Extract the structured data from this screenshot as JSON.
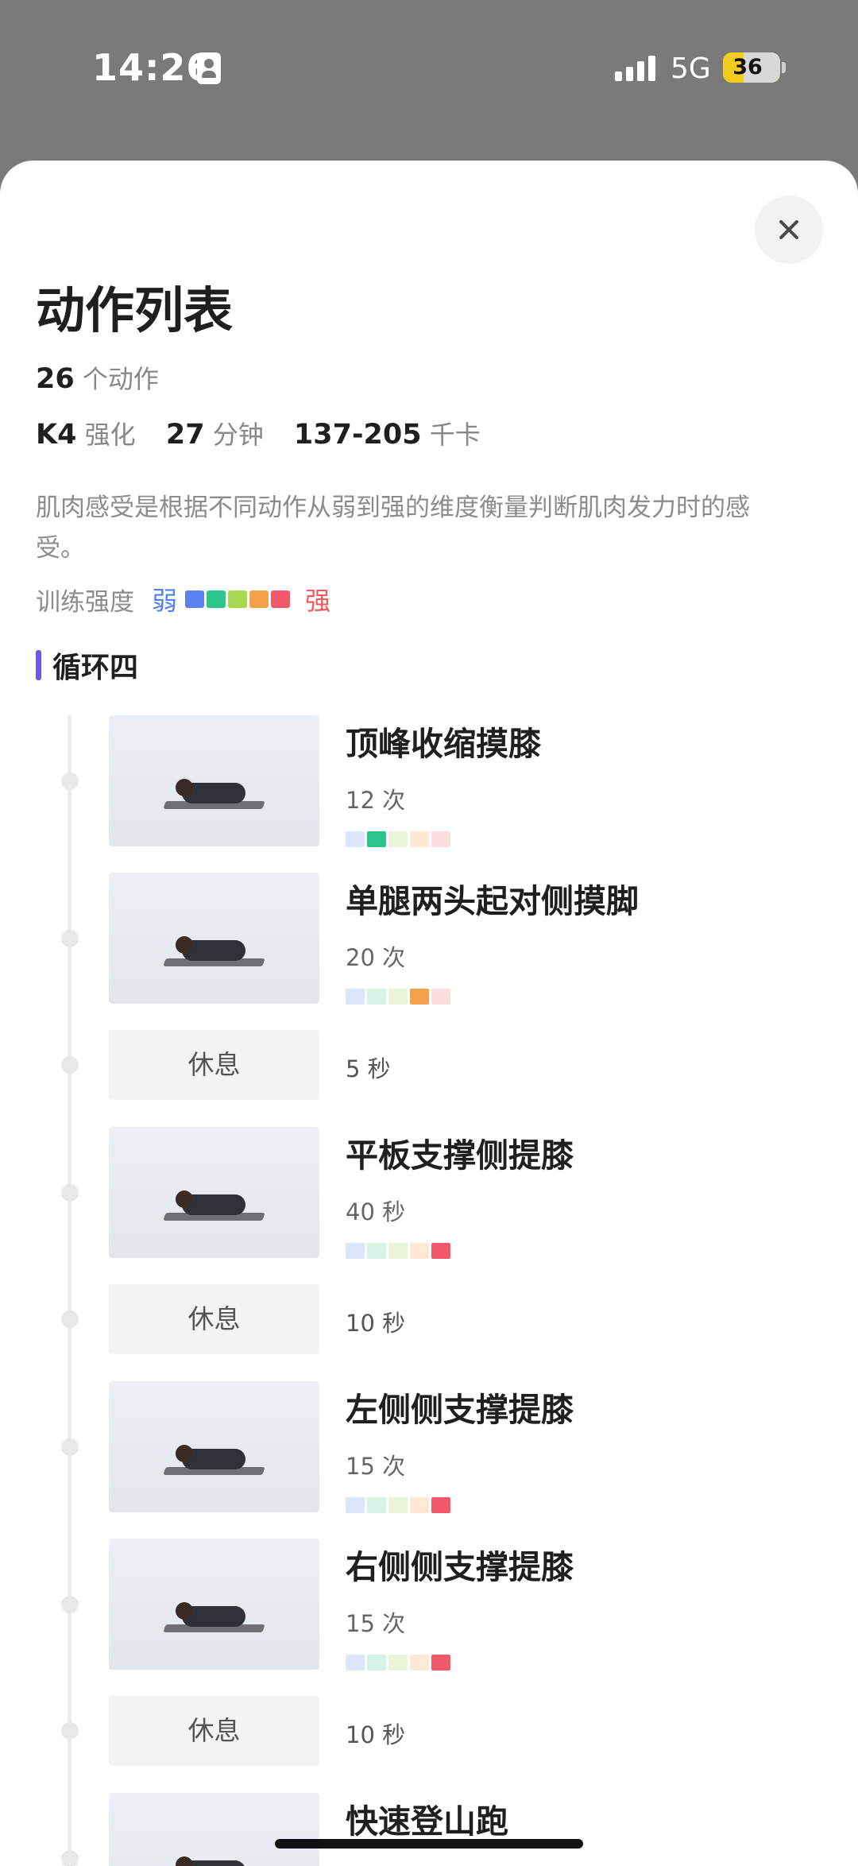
{
  "status_bar": {
    "time": "14:26",
    "network": "5G",
    "battery_level": "36",
    "battery_fraction": 0.36
  },
  "sheet": {
    "title": "动作列表",
    "action_count_value": "26",
    "action_count_unit": "个动作",
    "level_value": "K4",
    "level_unit": "强化",
    "duration_value": "27",
    "duration_unit": "分钟",
    "calories_value": "137-205",
    "calories_unit": "千卡",
    "description": "肌肉感受是根据不同动作从弱到强的维度衡量判断肌肉发力时的感受。",
    "intensity_label": "训练强度",
    "weak_label": "弱",
    "strong_label": "强",
    "intensity_colors": [
      "#5b82ee",
      "#2bc48a",
      "#a6d94f",
      "#f5a04a",
      "#f0596a"
    ],
    "intensity_dim_colors": [
      "#dde6fb",
      "#d5f2e5",
      "#e9f4d9",
      "#fde9d5",
      "#fcdde0"
    ],
    "circuit_label": "循环四"
  },
  "items": [
    {
      "type": "exercise",
      "name": "顶峰收缩摸膝",
      "count": "12 次",
      "intensity": 2
    },
    {
      "type": "exercise",
      "name": "单腿两头起对侧摸脚",
      "count": "20 次",
      "intensity": 4
    },
    {
      "type": "rest",
      "name": "休息",
      "count": "5 秒"
    },
    {
      "type": "exercise",
      "name": "平板支撑侧提膝",
      "count": "40 秒",
      "intensity": 5
    },
    {
      "type": "rest",
      "name": "休息",
      "count": "10 秒"
    },
    {
      "type": "exercise",
      "name": "左侧侧支撑提膝",
      "count": "15 次",
      "intensity": 5
    },
    {
      "type": "exercise",
      "name": "右侧侧支撑提膝",
      "count": "15 次",
      "intensity": 5
    },
    {
      "type": "rest",
      "name": "休息",
      "count": "10 秒"
    },
    {
      "type": "exercise",
      "name": "快速登山跑",
      "count": "",
      "intensity": 0
    }
  ]
}
